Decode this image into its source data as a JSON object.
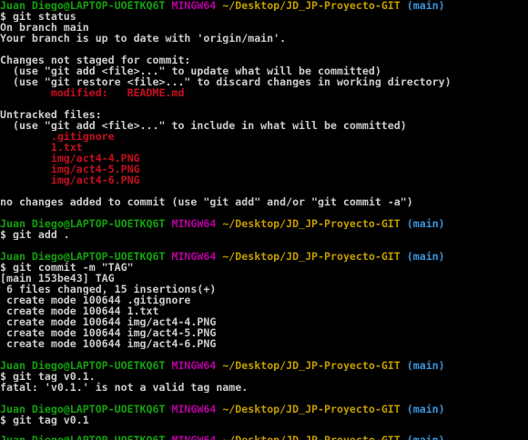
{
  "prompt": {
    "user": "Juan Diego@LAPTOP-UOETKQ6T",
    "shell": "MINGW64",
    "path": "~/Desktop/JD_JP-Proyecto-GIT",
    "branch": "(main)"
  },
  "block1": {
    "cmd": "$ git status",
    "l1": "On branch main",
    "l2": "Your branch is up to date with 'origin/main'.",
    "l3": "Changes not staged for commit:",
    "l4": "  (use \"git add <file>...\" to update what will be committed)",
    "l5": "  (use \"git restore <file>...\" to discard changes in working directory)",
    "mod_label": "        modified:   README.md",
    "l6": "Untracked files:",
    "l7": "  (use \"git add <file>...\" to include in what will be committed)",
    "untracked": [
      "        .gitignore",
      "        1.txt",
      "        img/act4-4.PNG",
      "        img/act4-5.PNG",
      "        img/act4-6.PNG"
    ],
    "l8": "no changes added to commit (use \"git add\" and/or \"git commit -a\")"
  },
  "block2": {
    "cmd": "$ git add ."
  },
  "block3": {
    "cmd": "$ git commit -m \"TAG\"",
    "out": [
      "[main 153be43] TAG",
      " 6 files changed, 15 insertions(+)",
      " create mode 100644 .gitignore",
      " create mode 100644 1.txt",
      " create mode 100644 img/act4-4.PNG",
      " create mode 100644 img/act4-5.PNG",
      " create mode 100644 img/act4-6.PNG"
    ]
  },
  "block4": {
    "cmd": "$ git tag v0.1.",
    "out": "fatal: 'v0.1.' is not a valid tag name."
  },
  "block5": {
    "cmd": "$ git tag v0.1"
  }
}
